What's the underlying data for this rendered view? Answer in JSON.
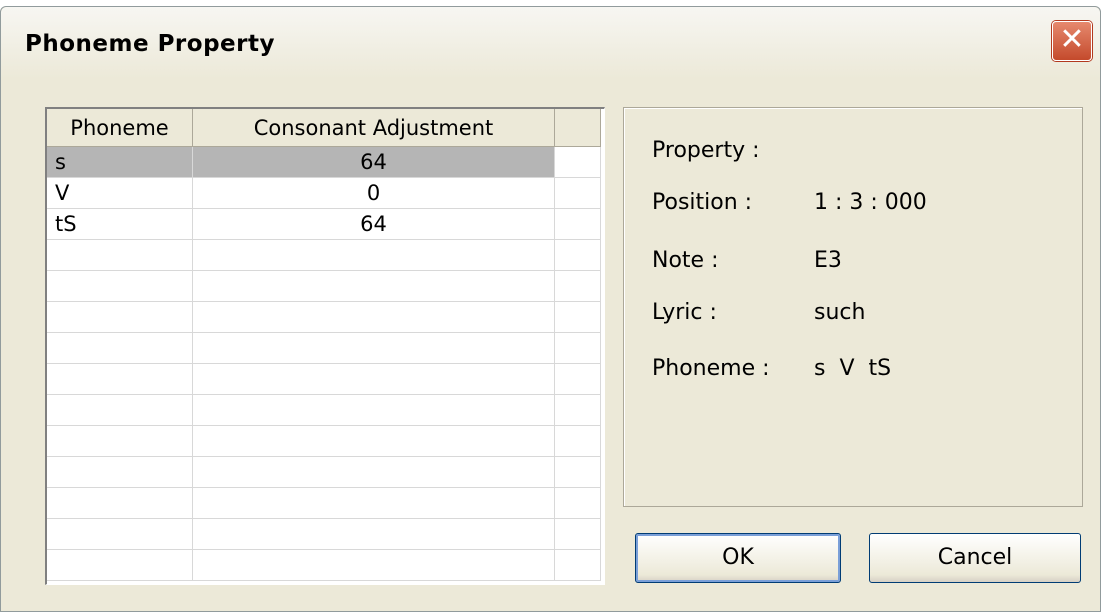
{
  "window": {
    "title": "Phoneme Property"
  },
  "table": {
    "headers": [
      "Phoneme",
      "Consonant Adjustment",
      ""
    ],
    "rows": [
      {
        "phoneme": "s",
        "adjustment": "64",
        "selected": true
      },
      {
        "phoneme": "V",
        "adjustment": "0",
        "selected": false
      },
      {
        "phoneme": "tS",
        "adjustment": "64",
        "selected": false
      }
    ],
    "empty_row_count": 11
  },
  "property": {
    "heading": "Property :",
    "fields": [
      {
        "label": "Position :",
        "value": "1 : 3 : 000"
      },
      {
        "label": "Note :",
        "value": "E3"
      },
      {
        "label": "Lyric :",
        "value": "such"
      },
      {
        "label": "Phoneme :",
        "value": "s  V  tS"
      }
    ]
  },
  "buttons": {
    "ok": "OK",
    "cancel": "Cancel"
  },
  "icons": {
    "close": "close-icon"
  },
  "colors": {
    "face": "#ece9d8",
    "selected_row": "#b5b5b5",
    "close_button": "#c44a2c"
  }
}
